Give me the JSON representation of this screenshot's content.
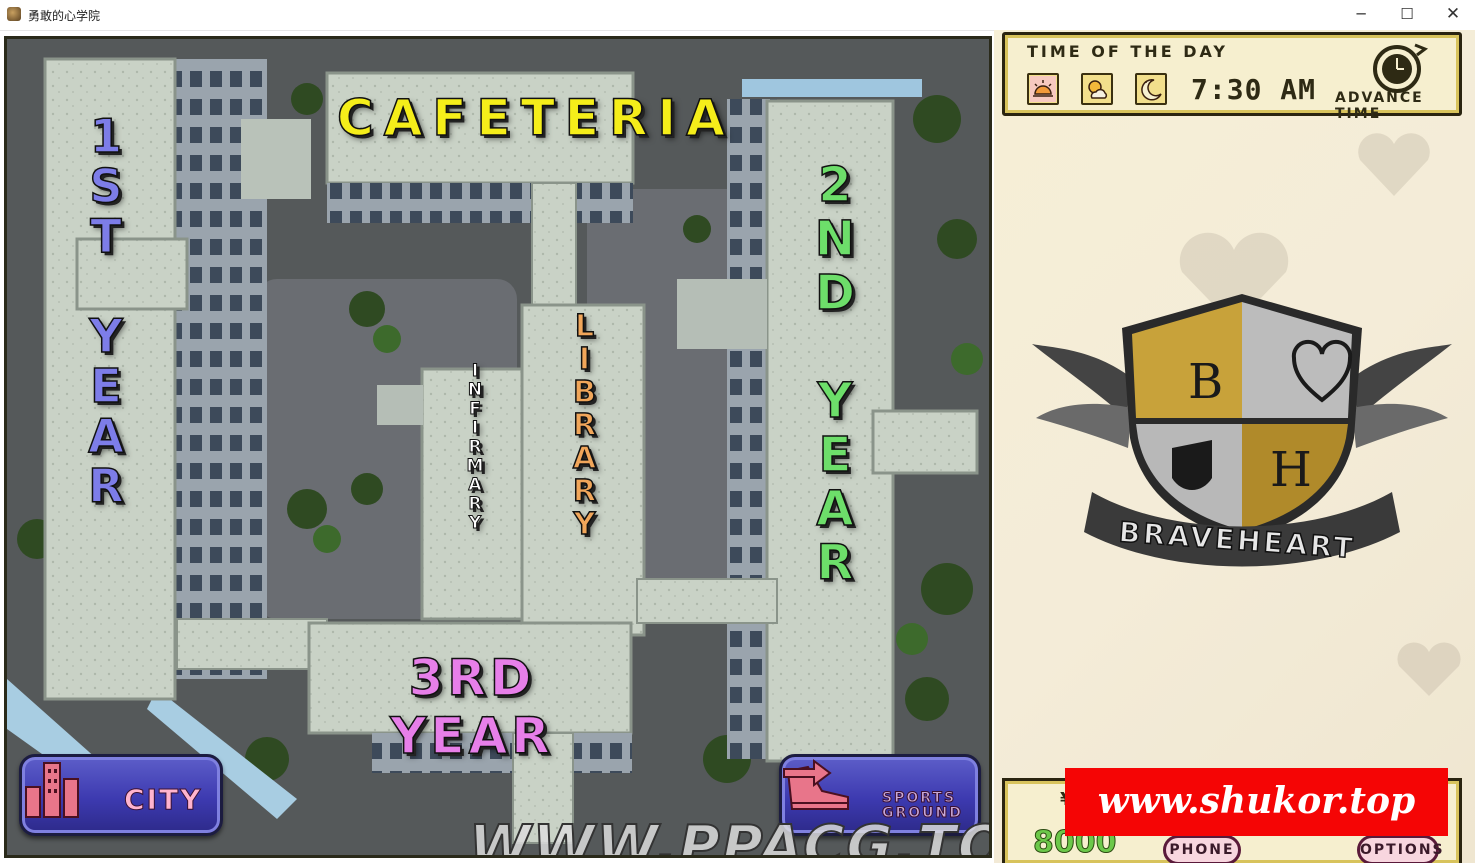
{
  "window": {
    "title": "勇敢的心学院",
    "minimize_glyph": "─",
    "maximize_glyph": "☐",
    "close_glyph": "✕"
  },
  "map": {
    "buildings": {
      "cafeteria": "CAFETERIA",
      "first_year": "1ST YEAR",
      "second_year": "2ND YEAR",
      "library": "LIBRARY",
      "infirmary": "INFIRMARY",
      "third_year": "3RD YEAR"
    },
    "label_colors": {
      "cafeteria": "#f5ee1a",
      "first_year": "#7d7de8",
      "second_year": "#6dde6a",
      "library": "#f1a65a",
      "third_year": "#e77fe9"
    },
    "city_button": {
      "label": "CITY",
      "icon": "city-buildings-icon"
    },
    "sports_button": {
      "label": "SPORTS GROUND",
      "icons": [
        "sneaker-icon",
        "right-arrow-icon"
      ]
    },
    "watermark": "WWW.PPACG.TOP"
  },
  "time_panel": {
    "title": "TIME OF THE DAY",
    "periods": [
      "morning-sun-icon",
      "afternoon-sun-cloud-icon",
      "night-moon-icon"
    ],
    "time": "7:30 AM",
    "advance_label": "ADVANCE TIME"
  },
  "crest": {
    "letter_top_left": "B",
    "letter_bottom_right": "H",
    "banner": "BRAVEHEART"
  },
  "bottom_panel": {
    "money_label": "¥",
    "money": "8000",
    "phone_label": "PHONE",
    "options_label": "OPTIONS"
  },
  "overlay_watermark": "www.shukor.top"
}
